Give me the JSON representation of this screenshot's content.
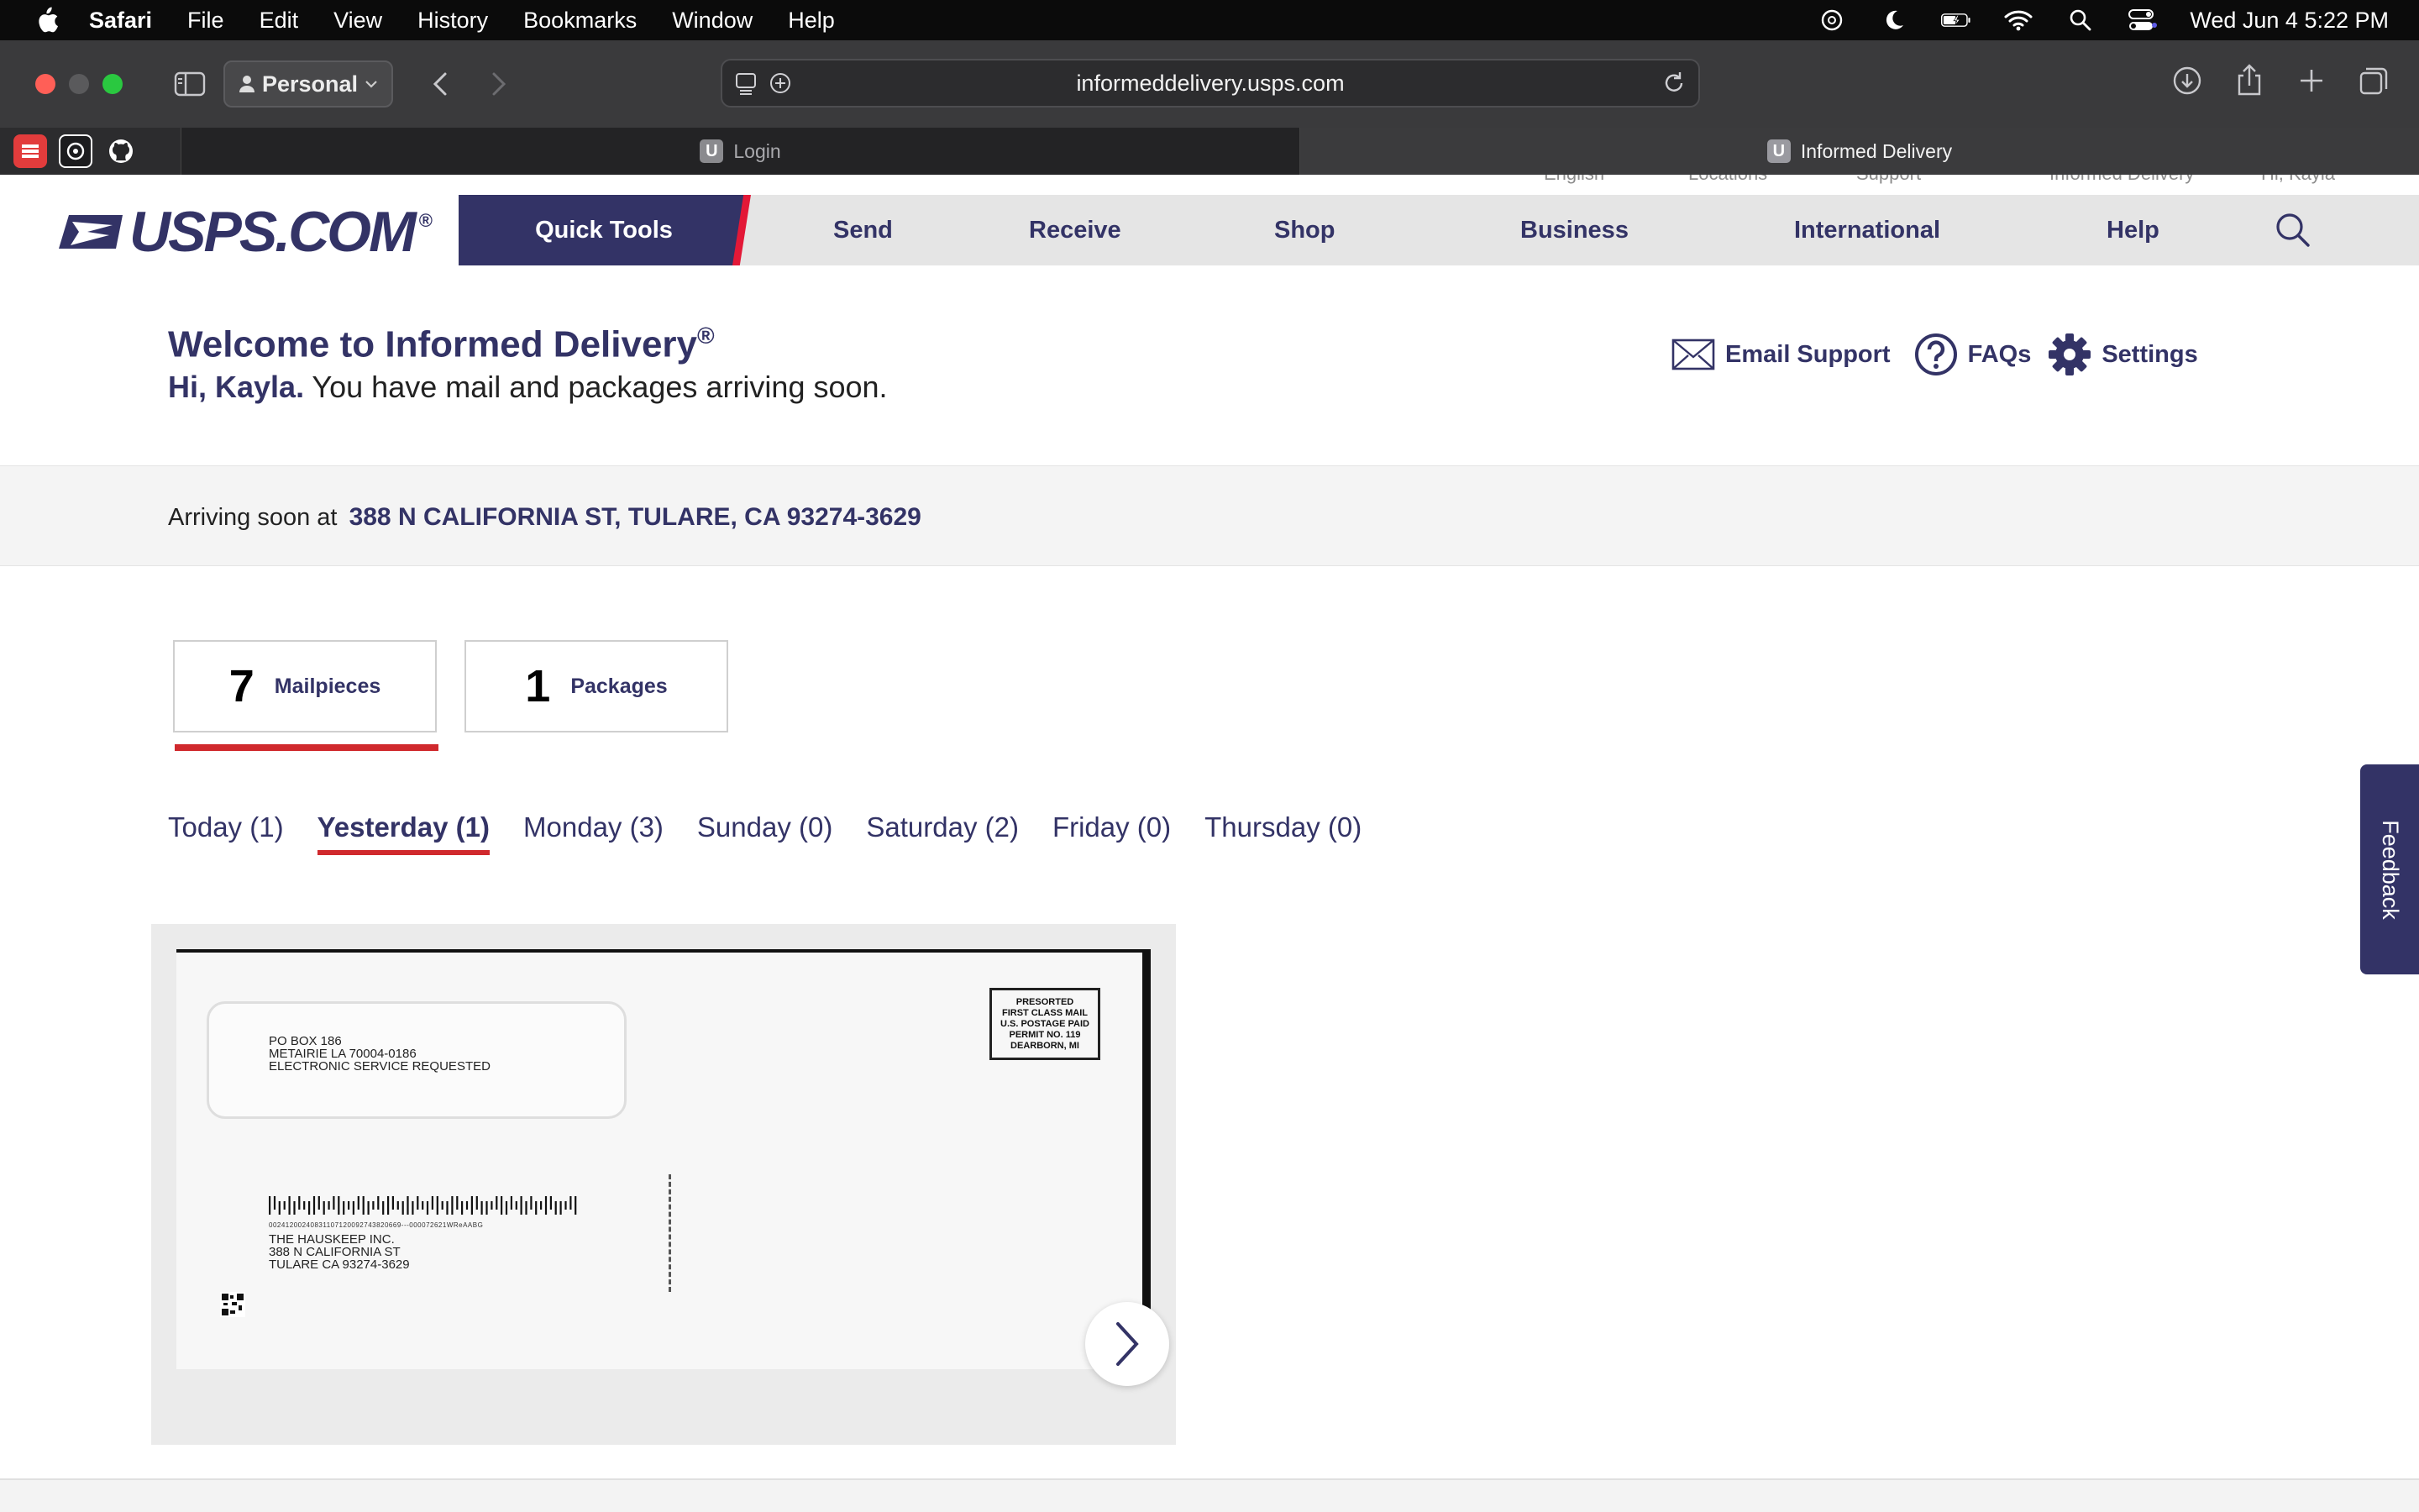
{
  "menubar": {
    "app": "Safari",
    "items": [
      "File",
      "Edit",
      "View",
      "History",
      "Bookmarks",
      "Window",
      "Help"
    ],
    "clock": "Wed Jun 4  5:22 PM"
  },
  "browser": {
    "profile": "Personal",
    "url": "informeddelivery.usps.com",
    "tabs": [
      {
        "title": "Login",
        "favicon": "U"
      },
      {
        "title": "Informed Delivery",
        "favicon": "U"
      }
    ]
  },
  "site": {
    "logo_text": "USPS.COM",
    "logo_reg": "®",
    "utility_ghost": [
      "English",
      "Locations",
      "Support",
      "Informed Delivery",
      "Hi, Kayla"
    ],
    "nav": [
      "Quick Tools",
      "Send",
      "Receive",
      "Shop",
      "Business",
      "International",
      "Help"
    ],
    "brand_color": "#333366",
    "accent_color": "#d0292d"
  },
  "welcome": {
    "title": "Welcome to Informed Delivery",
    "title_reg": "®",
    "greeting": "Hi, Kayla.",
    "message": " You have mail and packages arriving soon."
  },
  "help_links": [
    "Email Support",
    "FAQs",
    "Settings"
  ],
  "arriving": {
    "label": "Arriving soon at",
    "address": "388 N CALIFORNIA ST, TULARE, CA 93274-3629"
  },
  "counts": [
    {
      "num": "7",
      "label": "Mailpieces"
    },
    {
      "num": "1",
      "label": "Packages"
    }
  ],
  "days": [
    "Today (1)",
    "Yesterday (1)",
    "Monday (3)",
    "Sunday (0)",
    "Saturday (2)",
    "Friday (0)",
    "Thursday (0)"
  ],
  "mailpiece": {
    "sender": [
      "PO BOX 186",
      "METAIRIE LA 70004-0186",
      "ELECTRONIC SERVICE REQUESTED"
    ],
    "postage": [
      "PRESORTED",
      "FIRST CLASS MAIL",
      "U.S. POSTAGE PAID",
      "PERMIT NO. 119",
      "DEARBORN, MI"
    ],
    "barcode_digits": "00241200240831107120092743820669---000072621WReAABG",
    "recipient": [
      "THE HAUSKEEP INC.",
      "388 N CALIFORNIA ST",
      "TULARE CA 93274-3629"
    ]
  },
  "feedback": "Feedback"
}
